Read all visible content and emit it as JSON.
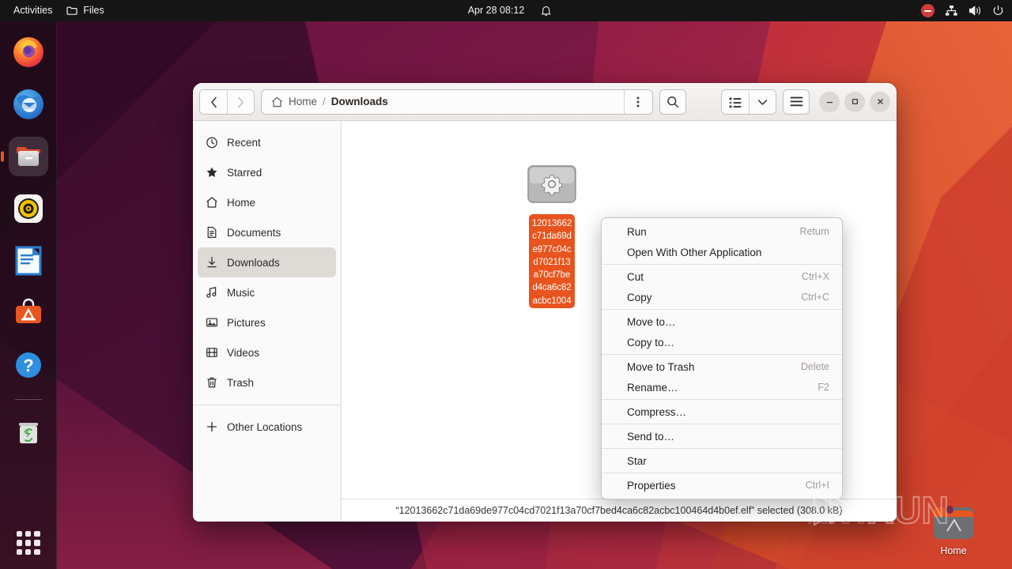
{
  "topbar": {
    "activities": "Activities",
    "app_name": "Files",
    "app_icon": "folder-icon",
    "clock": "Apr 28  08:12",
    "notification_icon": "bell-icon",
    "indicators": [
      {
        "name": "do-not-disturb-icon",
        "color": "#d13b3b"
      },
      {
        "name": "network-icon"
      },
      {
        "name": "volume-icon"
      },
      {
        "name": "power-icon"
      }
    ]
  },
  "dock": {
    "items": [
      {
        "name": "firefox",
        "label": "Firefox",
        "active": false
      },
      {
        "name": "thunderbird",
        "label": "Thunderbird",
        "active": false
      },
      {
        "name": "files",
        "label": "Files",
        "active": true
      },
      {
        "name": "rhythmbox",
        "label": "Rhythmbox",
        "active": false
      },
      {
        "name": "libreoffice-writer",
        "label": "LibreOffice Writer",
        "active": false
      },
      {
        "name": "ubuntu-software",
        "label": "Ubuntu Software",
        "active": false
      },
      {
        "name": "help",
        "label": "Help",
        "active": false
      },
      {
        "name": "trash",
        "label": "Trash",
        "active": false
      }
    ],
    "show_apps_label": "Show Applications"
  },
  "desktop": {
    "home_icon_label": "Home",
    "watermark": "ANY.RUN"
  },
  "window": {
    "header": {
      "back_label": "‹",
      "forward_label": "›",
      "path_root": "Home",
      "path_separator": "/",
      "path_current": "Downloads",
      "home_icon": "home-icon",
      "options_icon": "view-more-icon",
      "search_icon": "search-icon",
      "view_list_icon": "list-view-icon",
      "view_dropdown_icon": "chevron-down-icon",
      "hamburger_icon": "main-menu-icon",
      "minimize_label": "–",
      "maximize_label": "□",
      "close_label": "×"
    },
    "sidebar": {
      "items": [
        {
          "label": "Recent",
          "icon": "clock-icon",
          "selected": false
        },
        {
          "label": "Starred",
          "icon": "star-icon",
          "selected": false
        },
        {
          "label": "Home",
          "icon": "home-icon",
          "selected": false
        },
        {
          "label": "Documents",
          "icon": "document-icon",
          "selected": false
        },
        {
          "label": "Downloads",
          "icon": "download-icon",
          "selected": true
        },
        {
          "label": "Music",
          "icon": "music-note-icon",
          "selected": false
        },
        {
          "label": "Pictures",
          "icon": "image-icon",
          "selected": false
        },
        {
          "label": "Videos",
          "icon": "film-icon",
          "selected": false
        },
        {
          "label": "Trash",
          "icon": "trash-icon",
          "selected": false
        }
      ],
      "other_locations": {
        "label": "Other Locations",
        "icon": "plus-icon"
      }
    },
    "content": {
      "file": {
        "name": "12013662c71da69de977c04cd7021f13a70cf7bed4ca6c82acbc100464d4b0ef.elf",
        "icon": "executable-gear-icon",
        "selected": true
      }
    },
    "statusbar": {
      "text": "“12013662c71da69de977c04cd7021f13a70cf7bed4ca6c82acbc100464d4b0ef.elf” selected  (308.0 kB)"
    }
  },
  "context_menu": {
    "groups": [
      [
        {
          "label": "Run",
          "accel": "Return"
        },
        {
          "label": "Open With Other Application",
          "accel": ""
        }
      ],
      [
        {
          "label": "Cut",
          "accel": "Ctrl+X"
        },
        {
          "label": "Copy",
          "accel": "Ctrl+C"
        }
      ],
      [
        {
          "label": "Move to…",
          "accel": ""
        },
        {
          "label": "Copy to…",
          "accel": ""
        }
      ],
      [
        {
          "label": "Move to Trash",
          "accel": "Delete"
        },
        {
          "label": "Rename…",
          "accel": "F2"
        }
      ],
      [
        {
          "label": "Compress…",
          "accel": ""
        }
      ],
      [
        {
          "label": "Send to…",
          "accel": ""
        }
      ],
      [
        {
          "label": "Star",
          "accel": ""
        }
      ],
      [
        {
          "label": "Properties",
          "accel": "Ctrl+I"
        }
      ]
    ]
  },
  "colors": {
    "accent": "#e95420",
    "selection": "#e8541e",
    "topbar_bg": "#151515",
    "wallpaper_dark": "#3d0d2e",
    "wallpaper_red": "#c0392b"
  }
}
